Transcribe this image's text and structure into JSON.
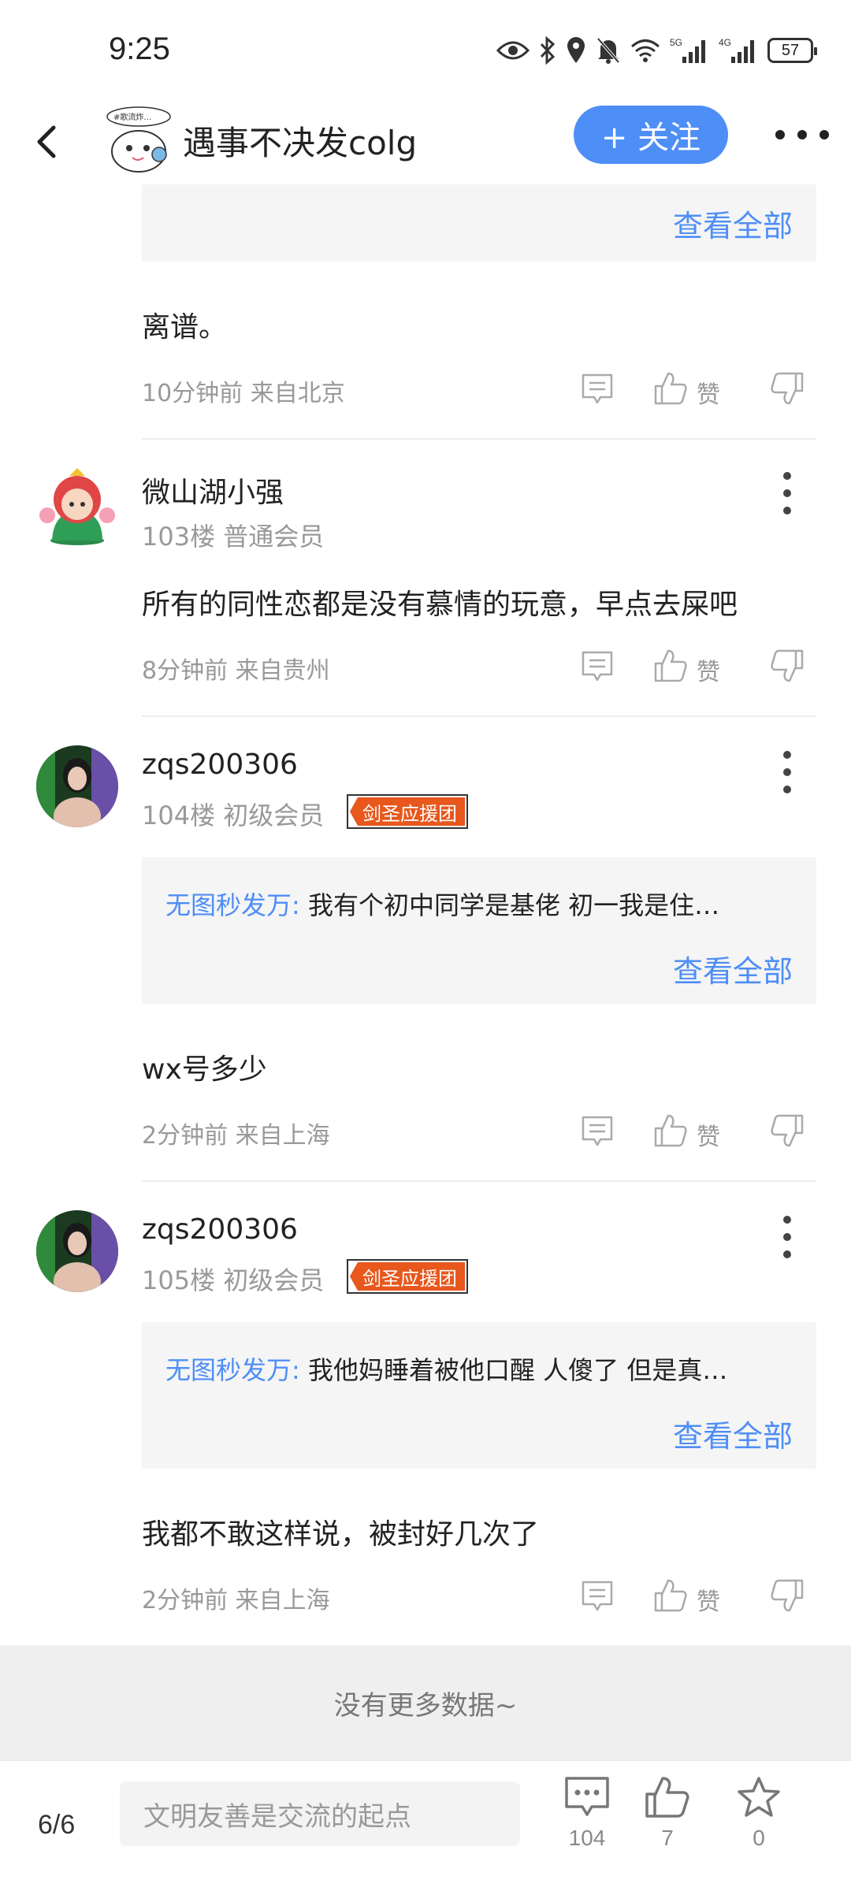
{
  "status_bar": {
    "time": "9:25",
    "battery": "57",
    "icons": [
      "eye-icon",
      "bluetooth-icon",
      "location-icon",
      "mute-bell-icon",
      "wifi-icon",
      "signal-5g-icon",
      "signal-4g-icon",
      "battery-icon"
    ],
    "network_labels": [
      "5G",
      "4G"
    ]
  },
  "header": {
    "title": "遇事不决发colg",
    "follow_label": "+ 关注",
    "avatar_caption": "#歌流炸…"
  },
  "comments": [
    {
      "view_all": "查看全部",
      "reply_text": "离谱。",
      "meta": "10分钟前 来自北京",
      "like_label": "赞"
    },
    {
      "username": "微山湖小强",
      "floor": "103楼 普通会员",
      "reply_text": "所有的同性恋都是没有慕情的玩意，早点去屎吧",
      "meta": "8分钟前 来自贵州",
      "like_label": "赞"
    },
    {
      "username": "zqs200306",
      "floor": "104楼 初级会员",
      "badge": "剑圣应援团",
      "quote_author": "无图秒发万:",
      "quote_text": " 我有个初中同学是基佬   初一我是住…",
      "view_all": "查看全部",
      "reply_text": "wx号多少",
      "meta": "2分钟前 来自上海",
      "like_label": "赞"
    },
    {
      "username": "zqs200306",
      "floor": "105楼 初级会员",
      "badge": "剑圣应援团",
      "quote_author": "无图秒发万:",
      "quote_text": " 我他妈睡着被他口醒   人傻了  但是真…",
      "view_all": "查看全部",
      "reply_text": "我都不敢这样说，被封好几次了",
      "meta": "2分钟前 来自上海",
      "like_label": "赞"
    }
  ],
  "end_text": "没有更多数据~",
  "bottom_bar": {
    "page": "6/6",
    "input_placeholder": "文明友善是交流的起点",
    "comments_count": "104",
    "likes_count": "7",
    "favorites_count": "0"
  },
  "colors": {
    "accent": "#4e8ef7",
    "badge": "#e8571c",
    "quote_bg": "#f5f5f5",
    "muted_text": "#999999"
  }
}
